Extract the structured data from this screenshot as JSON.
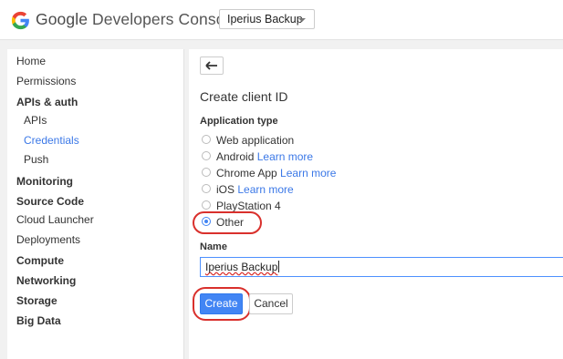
{
  "header": {
    "brand_google": "Google",
    "brand_rest": "Developers Console",
    "project_name": "Iperius Backup"
  },
  "sidebar": {
    "items": [
      {
        "label": "Home"
      },
      {
        "label": "Permissions"
      },
      {
        "label": "APIs & auth"
      },
      {
        "label": "APIs"
      },
      {
        "label": "Credentials"
      },
      {
        "label": "Push"
      },
      {
        "label": "Monitoring"
      },
      {
        "label": "Source Code"
      },
      {
        "label": "Cloud Launcher"
      },
      {
        "label": "Deployments"
      },
      {
        "label": "Compute"
      },
      {
        "label": "Networking"
      },
      {
        "label": "Storage"
      },
      {
        "label": "Big Data"
      }
    ]
  },
  "form": {
    "title": "Create client ID",
    "application_type_label": "Application type",
    "options": [
      {
        "label": "Web application",
        "link": "",
        "selected": false
      },
      {
        "label": "Android",
        "link": "Learn more",
        "selected": false
      },
      {
        "label": "Chrome App",
        "link": "Learn more",
        "selected": false
      },
      {
        "label": "iOS",
        "link": "Learn more",
        "selected": false
      },
      {
        "label": "PlayStation 4",
        "link": "",
        "selected": false
      },
      {
        "label": "Other",
        "link": "",
        "selected": true
      }
    ],
    "name_label": "Name",
    "name_value": "Iperius Backup",
    "create_label": "Create",
    "cancel_label": "Cancel"
  },
  "colors": {
    "accent": "#4285f4",
    "link": "#3b78e7",
    "highlight_ring": "#d9302c"
  }
}
